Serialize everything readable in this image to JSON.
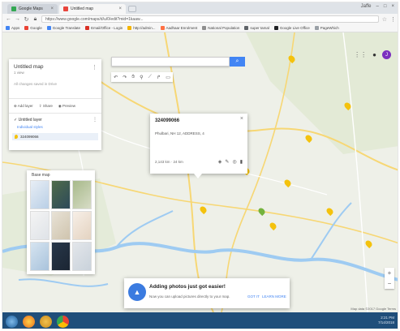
{
  "browser": {
    "tabs": [
      {
        "label": "Google Maps"
      },
      {
        "label": "Untitled map"
      }
    ],
    "window_controls": "Jaffe",
    "url": "https://www.google.com/maps/d/u/0/edit?mid=1kaaw...",
    "bookmarks": [
      {
        "label": "Apps"
      },
      {
        "label": "Google"
      },
      {
        "label": "Google Translate"
      },
      {
        "label": "Email/Office - Login"
      },
      {
        "label": "http://admin..."
      },
      {
        "label": "Aadhaar Enrolment"
      },
      {
        "label": "National Population"
      },
      {
        "label": "super tamal"
      },
      {
        "label": "Google Live Office"
      },
      {
        "label": "PageWhich"
      }
    ]
  },
  "map": {
    "search_placeholder": "",
    "search_button_icon": "search-icon",
    "tools": [
      "back",
      "forward",
      "hand",
      "marker",
      "line",
      "route",
      "ruler"
    ],
    "avatar_letter": "J",
    "panel": {
      "title": "Untitled map",
      "views": "1 view",
      "description": "All changes saved in Drive",
      "actions": [
        "Add layer",
        "Share",
        "Preview"
      ],
      "layer_title": "Untitled layer",
      "layer_style": "Individual styles",
      "layer_item": "324099066"
    },
    "basemap": {
      "title": "Base map"
    },
    "popup": {
      "title": "324099066",
      "address": "Phulbari, NH 12, ADDRESS, 4",
      "coords": "2,143 km  ·  24 km"
    },
    "toast": {
      "title": "Adding photos just got easier!",
      "description": "Now you can upload pictures directly to your map.",
      "got_it": "GOT IT",
      "learn_more": "LEARN MORE"
    },
    "attribution": "Map data ©2017 Google   Terms"
  },
  "taskbar": {
    "time": "2:21 PM",
    "date": "7/14/2018"
  },
  "colors": {
    "accent": "#4285f4",
    "avatar": "#7b2fbf",
    "taskbar": "#1f4e7a",
    "pin_yellow": "#f4c20d",
    "pin_green": "#74b33d",
    "river": "#9ecbf2"
  }
}
